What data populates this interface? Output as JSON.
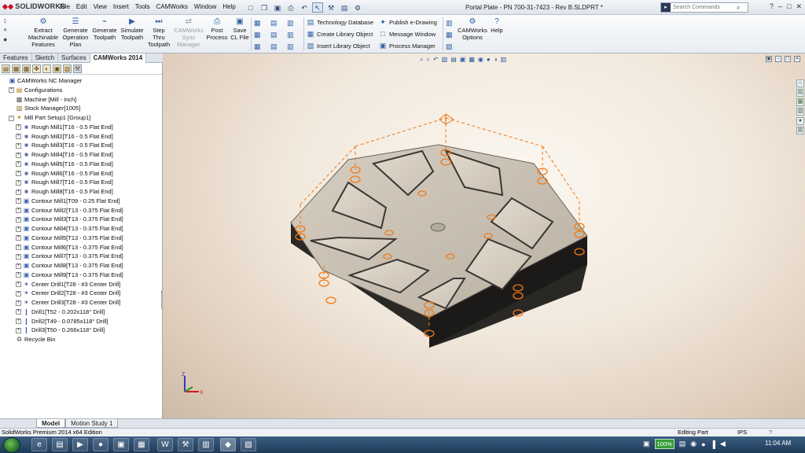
{
  "app": {
    "logo_text": "SOLIDWORKS",
    "doc_title": "Portal Plate - PN 700-31-7423 - Rev B.SLDPRT *"
  },
  "menu": [
    "File",
    "Edit",
    "View",
    "Insert",
    "Tools",
    "CAMWorks",
    "Window",
    "Help"
  ],
  "search": {
    "placeholder": "Search Commands"
  },
  "command_manager": {
    "buttons": [
      {
        "id": "extract",
        "label": "Extract Machinable Features"
      },
      {
        "id": "gen-op",
        "label": "Generate Operation Plan"
      },
      {
        "id": "gen-tp",
        "label": "Generate Toolpath"
      },
      {
        "id": "sim-tp",
        "label": "Simulate Toolpath"
      },
      {
        "id": "step-tp",
        "label": "Step Thru Toolpath"
      },
      {
        "id": "sync",
        "label": "CAMWorks Sync Manager"
      },
      {
        "id": "post",
        "label": "Post Process"
      },
      {
        "id": "savecl",
        "label": "Save CL File"
      }
    ],
    "links_left": [
      "Technology Database",
      "Create Library Object",
      "Insert Library Object"
    ],
    "links_right": [
      "Publish e-Drawing",
      "Message Window",
      "Process Manager"
    ],
    "options_label": "CAMWorks Options",
    "help_label": "Help"
  },
  "panel_tabs": [
    "Features",
    "Sketch",
    "Surfaces",
    "CAMWorks 2014"
  ],
  "tree": [
    {
      "label": "CAMWorks NC Manager",
      "level": 0,
      "icon": "nc-manager-icon",
      "glyph": "▣",
      "exp": "",
      "color": "#2b5aa8"
    },
    {
      "label": "Configurations",
      "level": 1,
      "icon": "configurations-icon",
      "glyph": "▤",
      "exp": "+",
      "color": "#b07a10"
    },
    {
      "label": "Machine [Mill - inch]",
      "level": 1,
      "icon": "machine-icon",
      "glyph": "▩",
      "exp": "",
      "color": "#555"
    },
    {
      "label": "Stock Manager[1005]",
      "level": 1,
      "icon": "stock-icon",
      "glyph": "▨",
      "exp": "",
      "color": "#8a6d2a"
    },
    {
      "label": "Mill Part Setup1 [Group1]",
      "level": 1,
      "icon": "setup-icon",
      "glyph": "✦",
      "exp": "−",
      "color": "#c08a00"
    },
    {
      "label": "Rough Mill1[T16 - 0.5 Flat End]",
      "level": 2,
      "icon": "rough-mill-icon",
      "glyph": "■",
      "exp": "+",
      "color": "#5b6fa8"
    },
    {
      "label": "Rough Mill2[T16 - 0.5 Flat End]",
      "level": 2,
      "icon": "rough-mill-icon",
      "glyph": "■",
      "exp": "+",
      "color": "#5b6fa8"
    },
    {
      "label": "Rough Mill3[T16 - 0.5 Flat End]",
      "level": 2,
      "icon": "rough-mill-icon",
      "glyph": "■",
      "exp": "+",
      "color": "#5b6fa8"
    },
    {
      "label": "Rough Mill4[T16 - 0.5 Flat End]",
      "level": 2,
      "icon": "rough-mill-icon",
      "glyph": "■",
      "exp": "+",
      "color": "#5b6fa8"
    },
    {
      "label": "Rough Mill5[T16 - 0.5 Flat End]",
      "level": 2,
      "icon": "rough-mill-icon",
      "glyph": "■",
      "exp": "+",
      "color": "#5b6fa8"
    },
    {
      "label": "Rough Mill6[T16 - 0.5 Flat End]",
      "level": 2,
      "icon": "rough-mill-icon",
      "glyph": "■",
      "exp": "+",
      "color": "#5b6fa8"
    },
    {
      "label": "Rough Mill7[T16 - 0.5 Flat End]",
      "level": 2,
      "icon": "rough-mill-icon",
      "glyph": "■",
      "exp": "+",
      "color": "#5b6fa8"
    },
    {
      "label": "Rough Mill8[T16 - 0.5 Flat End]",
      "level": 2,
      "icon": "rough-mill-icon",
      "glyph": "■",
      "exp": "+",
      "color": "#5b6fa8"
    },
    {
      "label": "Contour Mill1[T09 - 0.25 Flat End]",
      "level": 2,
      "icon": "contour-mill-icon",
      "glyph": "▣",
      "exp": "+",
      "color": "#3d62b0"
    },
    {
      "label": "Contour Mill2[T13 - 0.375 Flat End]",
      "level": 2,
      "icon": "contour-mill-icon",
      "glyph": "▣",
      "exp": "+",
      "color": "#3d62b0"
    },
    {
      "label": "Contour Mill3[T13 - 0.375 Flat End]",
      "level": 2,
      "icon": "contour-mill-icon",
      "glyph": "▣",
      "exp": "+",
      "color": "#3d62b0"
    },
    {
      "label": "Contour Mill4[T13 - 0.375 Flat End]",
      "level": 2,
      "icon": "contour-mill-icon",
      "glyph": "▣",
      "exp": "+",
      "color": "#3d62b0"
    },
    {
      "label": "Contour Mill5[T13 - 0.375 Flat End]",
      "level": 2,
      "icon": "contour-mill-icon",
      "glyph": "▣",
      "exp": "+",
      "color": "#3d62b0"
    },
    {
      "label": "Contour Mill6[T13 - 0.375 Flat End]",
      "level": 2,
      "icon": "contour-mill-icon",
      "glyph": "▣",
      "exp": "+",
      "color": "#3d62b0"
    },
    {
      "label": "Contour Mill7[T13 - 0.375 Flat End]",
      "level": 2,
      "icon": "contour-mill-icon",
      "glyph": "▣",
      "exp": "+",
      "color": "#3d62b0"
    },
    {
      "label": "Contour Mill8[T13 - 0.375 Flat End]",
      "level": 2,
      "icon": "contour-mill-icon",
      "glyph": "▣",
      "exp": "+",
      "color": "#3d62b0"
    },
    {
      "label": "Contour Mill9[T13 - 0.375 Flat End]",
      "level": 2,
      "icon": "contour-mill-icon",
      "glyph": "▣",
      "exp": "+",
      "color": "#3d62b0"
    },
    {
      "label": "Center Drill1[T28 - #3 Center Drill]",
      "level": 2,
      "icon": "center-drill-icon",
      "glyph": "✶",
      "exp": "+",
      "color": "#3d62b0"
    },
    {
      "label": "Center Drill2[T28 - #3 Center Drill]",
      "level": 2,
      "icon": "center-drill-icon",
      "glyph": "✶",
      "exp": "+",
      "color": "#3d62b0"
    },
    {
      "label": "Center Drill3[T28 - #3 Center Drill]",
      "level": 2,
      "icon": "center-drill-icon",
      "glyph": "✶",
      "exp": "+",
      "color": "#3d62b0"
    },
    {
      "label": "Drill1[T52 - 0.202x118° Drill]",
      "level": 2,
      "icon": "drill-icon",
      "glyph": "❙",
      "exp": "+",
      "color": "#3d62b0"
    },
    {
      "label": "Drill2[T49 - 0.0785x118° Drill]",
      "level": 2,
      "icon": "drill-icon",
      "glyph": "❙",
      "exp": "+",
      "color": "#3d62b0"
    },
    {
      "label": "Drill3[T50 - 0.266x118° Drill]",
      "level": 2,
      "icon": "drill-icon",
      "glyph": "❙",
      "exp": "+",
      "color": "#3d62b0"
    },
    {
      "label": "Recycle Bin",
      "level": 1,
      "icon": "recycle-bin-icon",
      "glyph": "♻",
      "exp": "",
      "color": "#555"
    }
  ],
  "bottom_tabs": [
    "Model",
    "Motion Study 1"
  ],
  "status": {
    "left": "SolidWorks Premium 2014 x64 Edition",
    "mode": "Editing Part",
    "units": "IPS",
    "help_icon": "help-icon"
  },
  "taskbar": {
    "battery": "100%",
    "clock": "11:04 AM"
  },
  "colors": {
    "toolpath": "#f07a18",
    "plate_top": "#c4bcae",
    "plate_side": "#2a2825",
    "accent": "#2d5fa3"
  }
}
